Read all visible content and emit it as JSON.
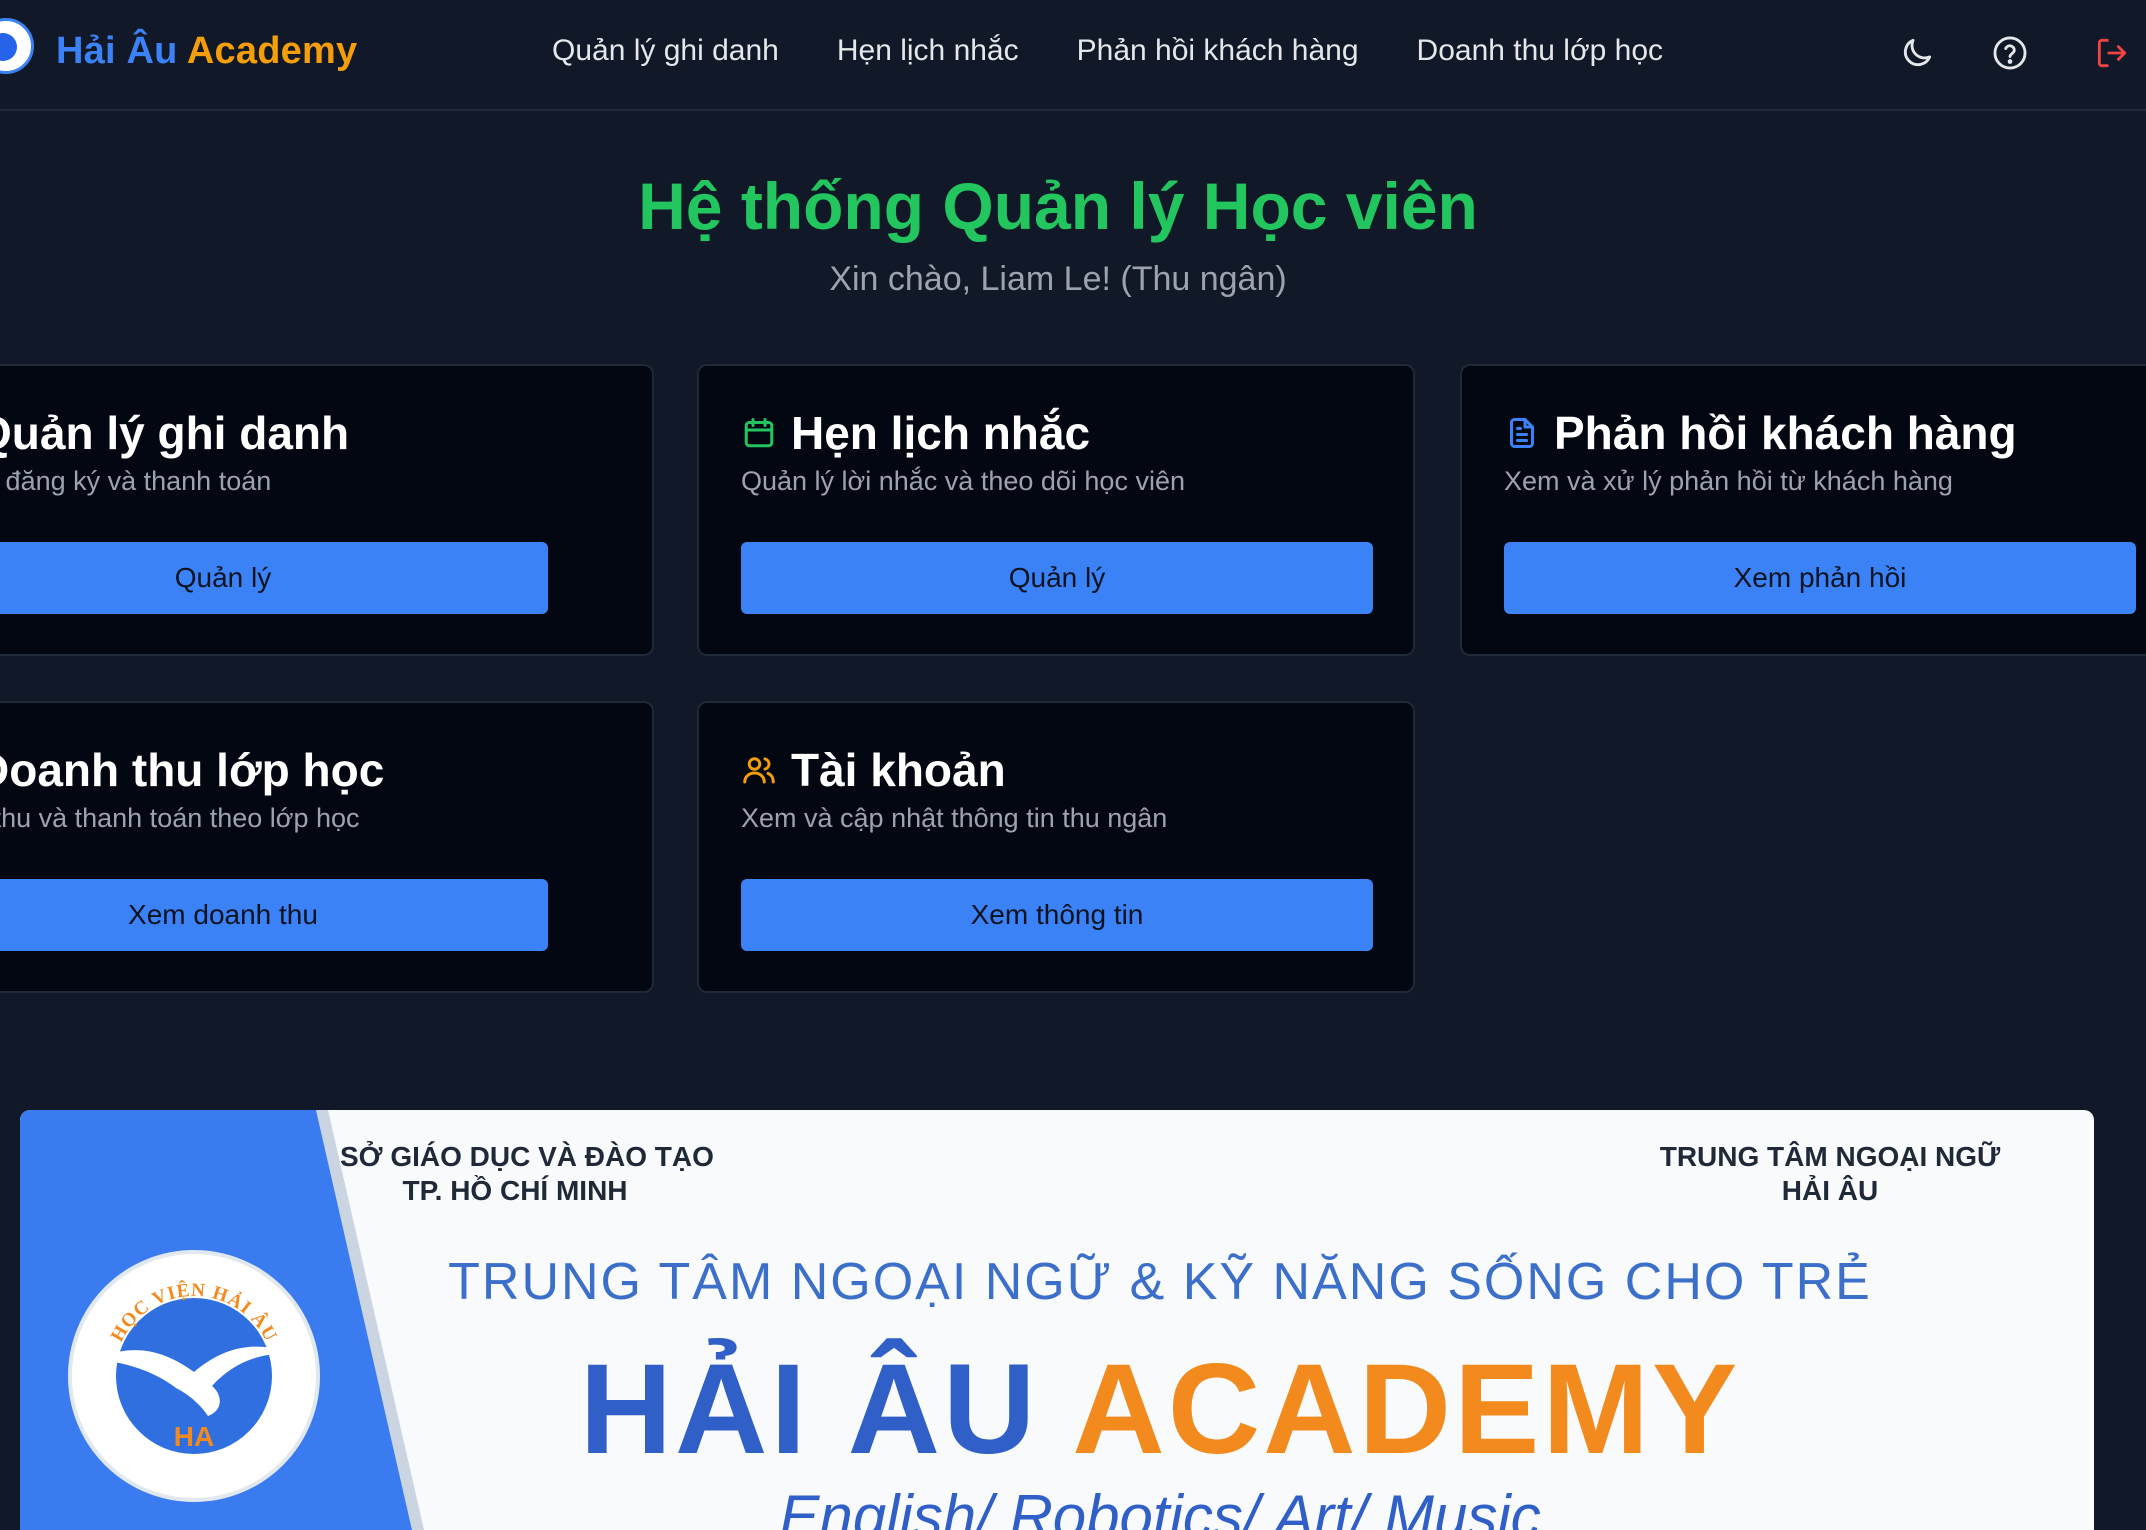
{
  "header": {
    "brand_part1": "Hải Âu",
    "brand_part2": "Academy",
    "nav": [
      {
        "label": "Quản lý ghi danh"
      },
      {
        "label": "Hẹn lịch nhắc"
      },
      {
        "label": "Phản hồi khách hàng"
      },
      {
        "label": "Doanh thu lớp học"
      }
    ],
    "icons": [
      "moon-icon",
      "help-icon",
      "logout-icon"
    ]
  },
  "hero": {
    "title": "Hệ thống Quản lý Học viên",
    "greeting": "Xin chào, Liam Le! (Thu ngân)"
  },
  "cards": [
    {
      "title": "Quản lý ghi danh",
      "desc": "uản lý đăng ký và thanh toán",
      "button": "Quản lý",
      "icon": "clipboard-icon",
      "icon_color": "#f97316"
    },
    {
      "title": "Hẹn lịch nhắc",
      "desc": "Quản lý lời nhắc và theo dõi học viên",
      "button": "Quản lý",
      "icon": "calendar-icon",
      "icon_color": "#22c55e"
    },
    {
      "title": "Phản hồi khách hàng",
      "desc": "Xem và xử lý phản hồi từ khách hàng",
      "button": "Xem phản hồi",
      "icon": "document-icon",
      "icon_color": "#3b82f6"
    },
    {
      "title": "Doanh thu lớp học",
      "desc": "oanh thu và thanh toán theo lớp học",
      "button": "Xem doanh thu",
      "icon": "users-icon",
      "icon_color": "#a855f7"
    },
    {
      "title": "Tài khoản",
      "desc": "Xem và cập nhật thông tin thu ngân",
      "button": "Xem thông tin",
      "icon": "users-icon",
      "icon_color": "#f59e0b"
    }
  ],
  "banner": {
    "top_left": [
      "SỞ GIÁO DỤC VÀ ĐÀO TẠO",
      "TP. HỒ CHÍ MINH"
    ],
    "top_right": [
      "TRUNG TÂM NGOẠI NGỮ",
      "HẢI ÂU"
    ],
    "subtitle": "TRUNG TÂM NGOẠI NGỮ & KỸ NĂNG SỐNG CHO TRẺ",
    "brand_part1": "HẢI ÂU",
    "brand_part2": "ACADEMY",
    "courses": "English/ Robotics/ Art/ Music",
    "seal_text": "HỌC VIỆN HẢI ÂU",
    "seal_mark": "HA"
  },
  "colors": {
    "background": "#111827",
    "card_background": "#030712",
    "accent_blue": "#3b82f6",
    "title_green": "#22c55e",
    "brand_orange": "#f59e0b"
  }
}
